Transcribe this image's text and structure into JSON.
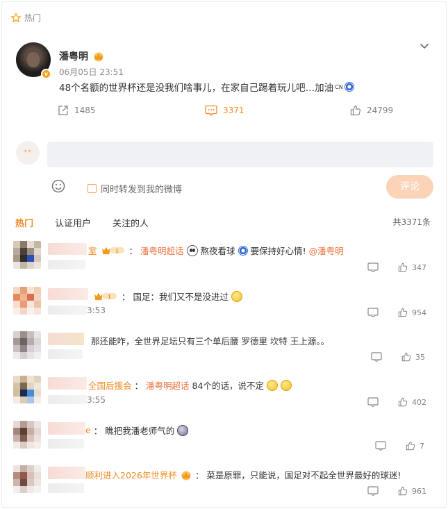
{
  "header": {
    "hot_label": "热门"
  },
  "post": {
    "author": "潘粤明",
    "verified_badge": "v",
    "time": "06月05日 23:51",
    "text": "48个名额的世界杯还是没我们啥事儿，在家自己踢着玩儿吧…加油",
    "flag_text": "CN",
    "stats": {
      "reposts": "1485",
      "comments": "3371",
      "likes": "24799"
    }
  },
  "composer": {
    "avatar_text": "**",
    "input_placeholder": "",
    "repost_label": "同时转发到我的微博",
    "submit_label": "评论"
  },
  "tabs": [
    {
      "label": "热门",
      "active": true
    },
    {
      "label": "认证用户",
      "active": false
    },
    {
      "label": "关注的人",
      "active": false
    }
  ],
  "total_comments": "共3371条",
  "colors": {
    "accent": "#f08b24",
    "submit_bg": "#fbd4b8",
    "input_bg": "#f0f1f4",
    "mention": "#eb7340"
  },
  "comments": [
    {
      "name_tail": "室",
      "level": "1",
      "colon": "：",
      "text_link": "潘粤明超话",
      "text_after": "熬夜看球",
      "text_after2": "要保持好心情!",
      "mention": "@潘粤明",
      "time": "",
      "replies": "",
      "likes": "347"
    },
    {
      "name_tail": "",
      "level": "1",
      "colon": "：",
      "text": "国足：我们又不是没进过",
      "time": "3:53",
      "likes": "954"
    },
    {
      "name_tail": "",
      "colon": "",
      "text": "那还能咋，全世界足坛只有三个单后腰 罗德里 坎特 王上源。。",
      "time": "",
      "likes": "35"
    },
    {
      "name_tail": "全国后援会",
      "colon": "：",
      "text_link": "潘粤明超话",
      "text": "84个的话，说不定",
      "time": "3:55",
      "likes": "402"
    },
    {
      "name_tail": "e",
      "colon": "：",
      "text": "瞧把我潘老师气的",
      "time": "",
      "likes": "7"
    },
    {
      "name_tail": "顺利进入2026年世界杯",
      "colon": "：",
      "text": "菜是原罪，只能说，国足对不起全世界最好的球迷!",
      "time": "",
      "likes": "961"
    }
  ]
}
